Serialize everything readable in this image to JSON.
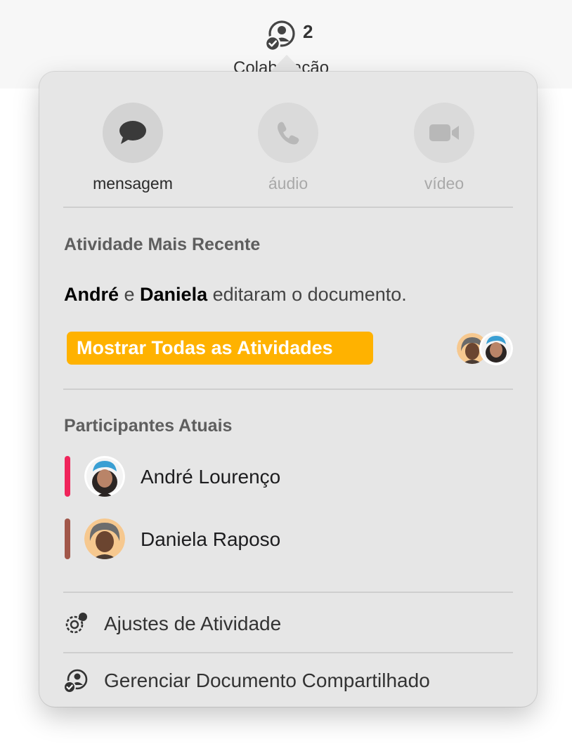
{
  "toolbar": {
    "collaborator_count": "2",
    "collaboration_label": "Colaboração"
  },
  "communication": {
    "message_label": "mensagem",
    "audio_label": "áudio",
    "video_label": "vídeo"
  },
  "recent_activity": {
    "heading": "Atividade Mais Recente",
    "person1": "André",
    "conjunction": " e ",
    "person2": "Daniela",
    "action": " editaram o documento.",
    "show_all_label": "Mostrar Todas as Atividades"
  },
  "participants": {
    "heading": "Participantes Atuais",
    "items": [
      {
        "name": "André Lourenço",
        "color": "#f0245b"
      },
      {
        "name": "Daniela Raposo",
        "color": "#a1574a"
      }
    ]
  },
  "menu": {
    "activity_settings_label": "Ajustes de Atividade",
    "manage_shared_label": "Gerenciar Documento Compartilhado"
  },
  "colors": {
    "accent": "#ffb200",
    "popover_bg": "#e6e6e6"
  }
}
